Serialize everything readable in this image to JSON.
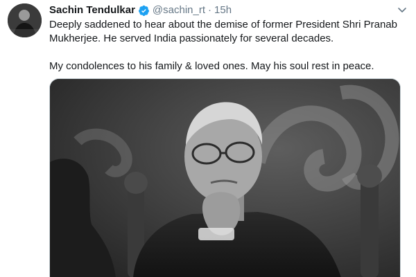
{
  "tweet": {
    "display_name": "Sachin Tendulkar",
    "handle": "@sachin_rt",
    "separator": "·",
    "time": "15h",
    "paragraphs": [
      "Deeply saddened to hear about the demise of former President Shri Pranab Mukherjee. He served India passionately for several decades.",
      "My condolences to his family & loved ones. May his soul rest in peace."
    ]
  },
  "icons": {
    "verified": "verified-badge-icon",
    "caret": "chevron-down-icon"
  },
  "colors": {
    "verified_blue": "#1da1f2",
    "secondary_text": "#657786",
    "primary_text": "#14171a"
  }
}
